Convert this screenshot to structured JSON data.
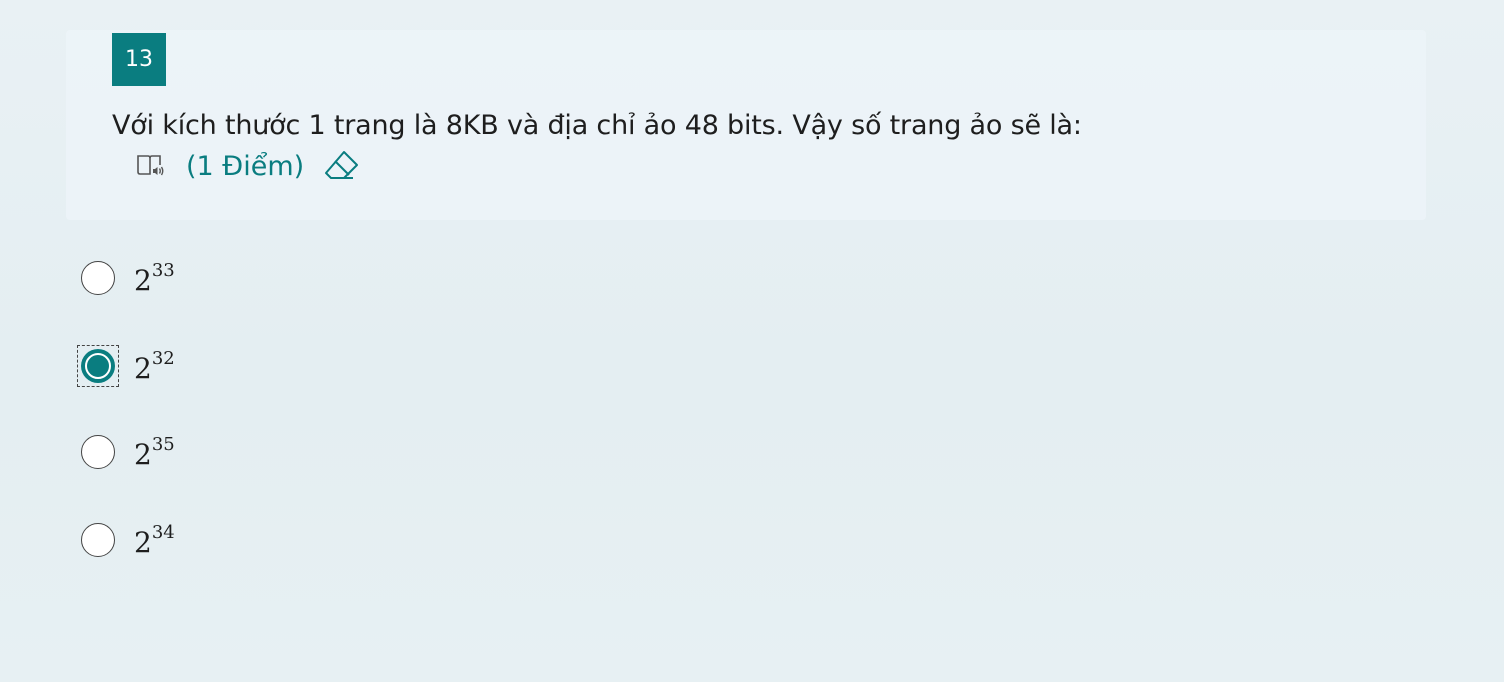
{
  "question": {
    "number": "13",
    "text": "Với kích thước 1 trang là 8KB và địa chỉ ảo 48 bits. Vậy số trang ảo sẽ là:",
    "points": "(1 Điểm)",
    "reader_icon": "immersive-reader-icon",
    "eraser_icon": "eraser-icon"
  },
  "accent_color": "#0a7d80",
  "options": [
    {
      "base": "2",
      "exponent": "33",
      "selected": false
    },
    {
      "base": "2",
      "exponent": "32",
      "selected": true
    },
    {
      "base": "2",
      "exponent": "35",
      "selected": false
    },
    {
      "base": "2",
      "exponent": "34",
      "selected": false
    }
  ]
}
